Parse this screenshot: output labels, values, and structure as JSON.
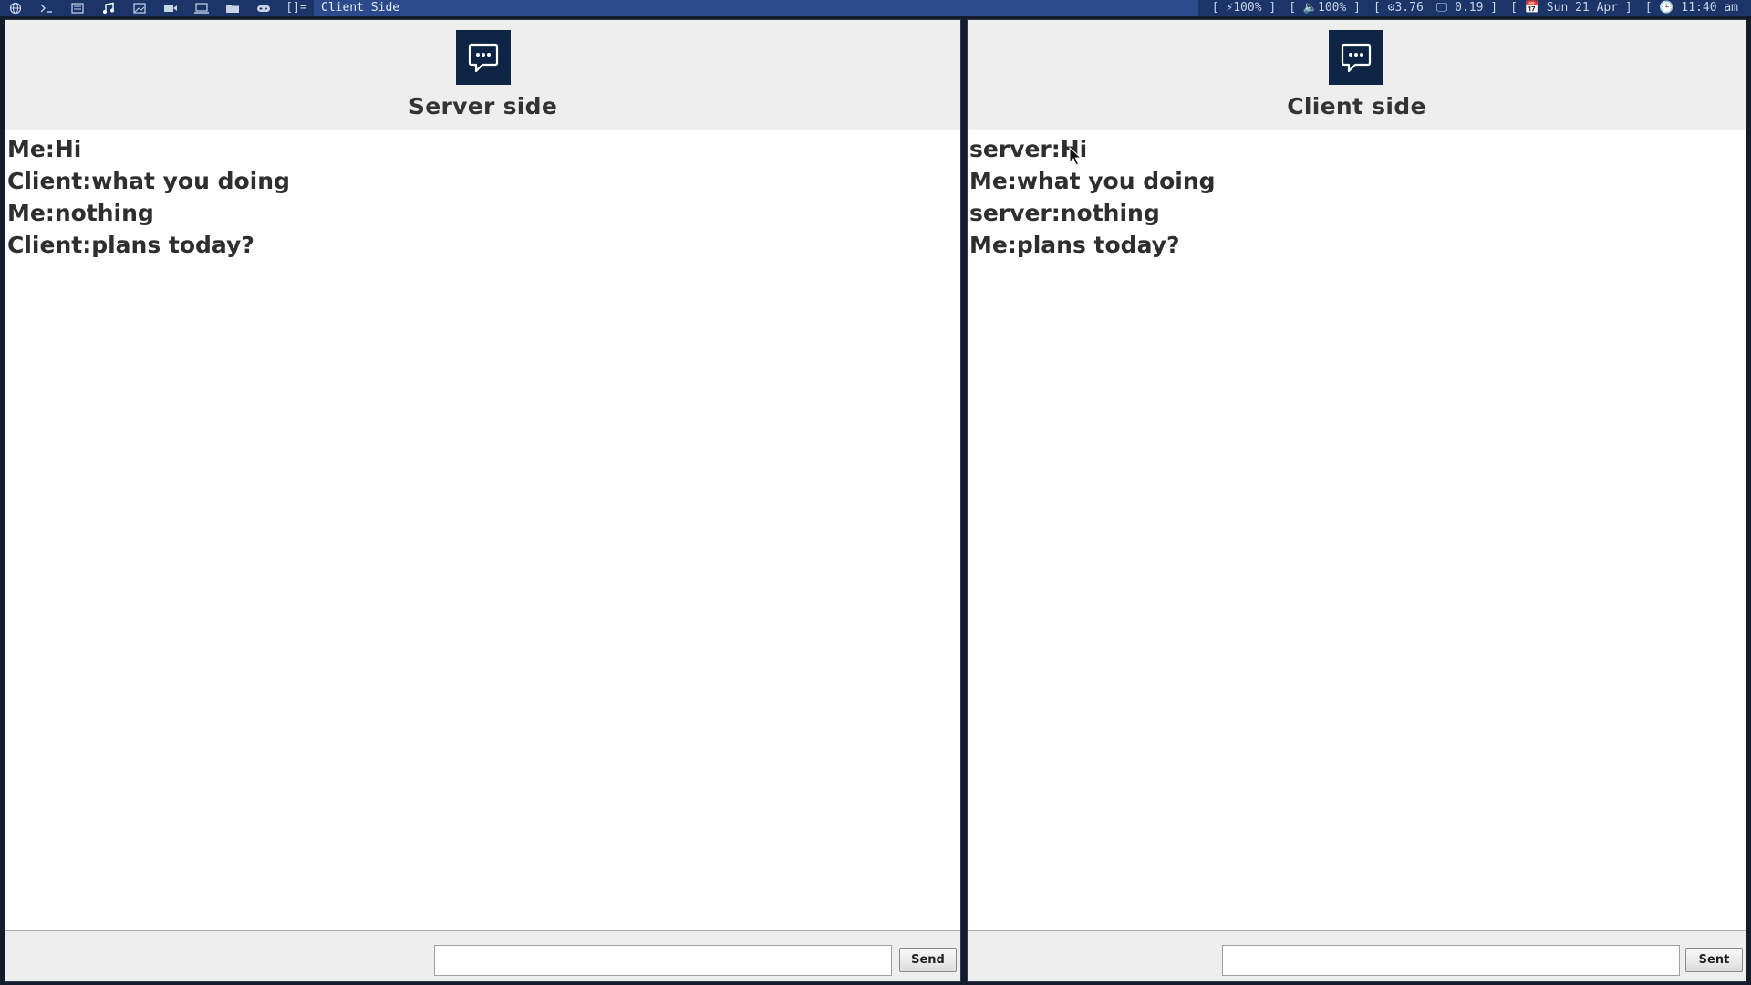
{
  "topbar": {
    "layout_indicator": "[]=",
    "window_title": "Client Side",
    "status": {
      "battery": "[ ⚡100% ]",
      "volume": "[ 🔈100% ]",
      "cpu": "[ ⚙3.76",
      "load": "🖵 0.19 ]",
      "date": "[ 📅 Sun 21 Apr ]",
      "time": "[ 🕒 11:40 am"
    }
  },
  "server_window": {
    "title": "Server side",
    "messages": [
      "Me:Hi",
      "Client:what you doing",
      "Me:nothing",
      "Client:plans today?"
    ],
    "input_value": "",
    "button_label": "Send"
  },
  "client_window": {
    "title": "Client side",
    "messages": [
      "server:Hi",
      "Me:what you doing",
      "server:nothing",
      "Me:plans today?"
    ],
    "input_value": "",
    "button_label": "Sent"
  },
  "colors": {
    "topbar_bg": "#1b3569",
    "title_highlight": "#2a4a8c",
    "logo_bg": "#0e2444",
    "window_bg": "#eeeeee"
  },
  "icons": {
    "workspace_icons": [
      "globe-icon",
      "terminal-icon",
      "files-icon",
      "music-icon",
      "image-icon",
      "video-icon",
      "monitor-icon",
      "folder-icon",
      "gamepad-icon"
    ],
    "chat_logo": "chat-bubble-icon"
  }
}
